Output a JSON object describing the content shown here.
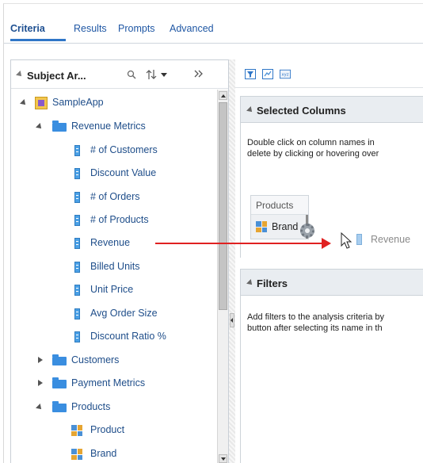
{
  "tabs": [
    {
      "label": "Criteria",
      "active": true
    },
    {
      "label": "Results",
      "active": false
    },
    {
      "label": "Prompts",
      "active": false
    },
    {
      "label": "Advanced",
      "active": false
    }
  ],
  "subject_area": {
    "title": "Subject Ar...",
    "icons": [
      "search-icon",
      "sort-icon",
      "collapse-panel-icon"
    ]
  },
  "tree": [
    {
      "label": "SampleApp",
      "type": "subject-area",
      "expanded": true
    },
    {
      "label": "Revenue Metrics",
      "type": "folder",
      "expanded": true
    },
    {
      "label": "# of Customers",
      "type": "measure"
    },
    {
      "label": "Discount Value",
      "type": "measure"
    },
    {
      "label": "# of Orders",
      "type": "measure"
    },
    {
      "label": "# of Products",
      "type": "measure"
    },
    {
      "label": "Revenue",
      "type": "measure"
    },
    {
      "label": "Billed Units",
      "type": "measure"
    },
    {
      "label": "Unit Price",
      "type": "measure"
    },
    {
      "label": "Avg Order Size",
      "type": "measure"
    },
    {
      "label": "Discount Ratio %",
      "type": "measure"
    },
    {
      "label": "Customers",
      "type": "folder",
      "expanded": false
    },
    {
      "label": "Payment Metrics",
      "type": "folder",
      "expanded": false
    },
    {
      "label": "Products",
      "type": "folder",
      "expanded": true
    },
    {
      "label": "Product",
      "type": "attribute"
    },
    {
      "label": "Brand",
      "type": "attribute"
    }
  ],
  "toolbar": {
    "icons": [
      "filter-icon",
      "edit-formula-icon",
      "xyz-icon"
    ],
    "xyz_label": "xyz"
  },
  "selected_columns": {
    "title": "Selected Columns",
    "help_line1": "Double click on column names in",
    "help_line2": "delete by clicking or hovering over",
    "table_header": "Products",
    "column": "Brand",
    "drag_ghost": "Revenue"
  },
  "filters": {
    "title": "Filters",
    "help_line1": "Add filters to the analysis criteria by",
    "help_line2": "button after selecting its name in th"
  },
  "colors": {
    "accent": "#2f76c7",
    "link": "#1f4e8a",
    "arrow": "#e02121",
    "section_bg": "#e9edf1"
  }
}
